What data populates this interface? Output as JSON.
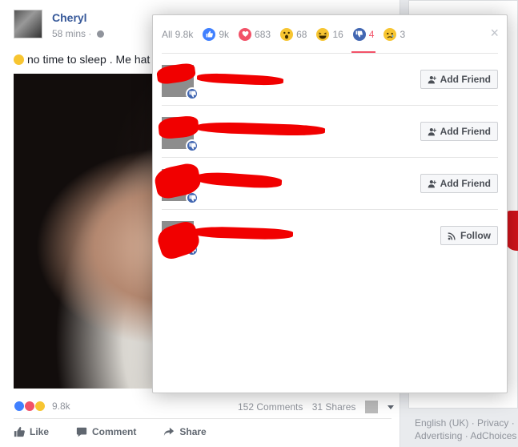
{
  "post": {
    "author": "Cheryl",
    "time": "58 mins",
    "text": "no time to sleep . Me hat",
    "reactions_count": "9.8k",
    "comments": "152 Comments",
    "shares": "31 Shares",
    "actions": {
      "like": "Like",
      "comment": "Comment",
      "share": "Share"
    }
  },
  "right": {
    "footer_line1": "English (UK) · Privacy ·",
    "footer_line2": "Advertising · AdChoices"
  },
  "dialog": {
    "tabs": [
      {
        "label": "All 9.8k",
        "icon": "none"
      },
      {
        "label": "9k",
        "icon": "like-icon",
        "color": "#4080ff"
      },
      {
        "label": "683",
        "icon": "love-icon",
        "color": "#f25268"
      },
      {
        "label": "68",
        "icon": "wow-icon",
        "color": "#f7c531"
      },
      {
        "label": "16",
        "icon": "haha-icon",
        "color": "#f7c531"
      },
      {
        "label": "4",
        "icon": "dislike-icon",
        "color": "#4267b2"
      },
      {
        "label": "3",
        "icon": "sad-icon",
        "color": "#f7c531"
      }
    ],
    "active_tab": 5,
    "close": "×",
    "people": [
      {
        "button": "Add Friend",
        "button_icon": "add-friend-icon"
      },
      {
        "button": "Add Friend",
        "button_icon": "add-friend-icon"
      },
      {
        "button": "Add Friend",
        "button_icon": "add-friend-icon"
      },
      {
        "button": "Follow",
        "button_icon": "rss-icon"
      }
    ]
  },
  "colors": {
    "accent": "#f25268",
    "link": "#365899",
    "brand": "#4267b2",
    "redaction": "#f10000"
  }
}
